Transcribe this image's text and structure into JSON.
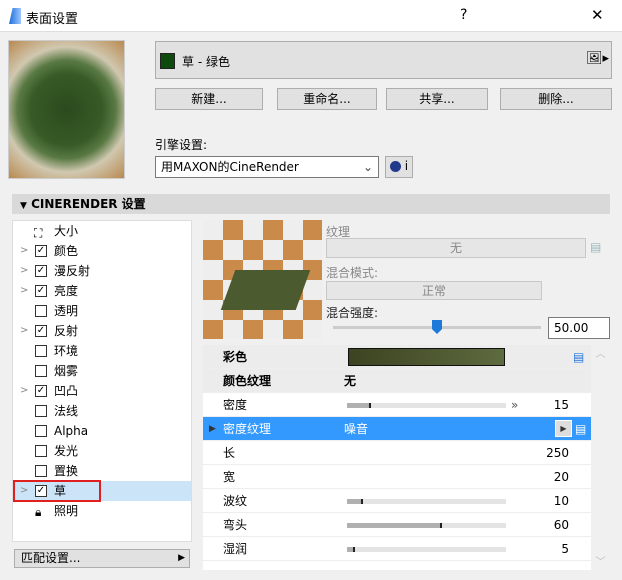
{
  "window": {
    "title": "表面设置",
    "help": "?",
    "close": "✕"
  },
  "material": {
    "name": "草 - 绿色",
    "swatch": "#0e4a0e"
  },
  "buttons": {
    "new": "新建...",
    "rename": "重命名...",
    "share": "共享...",
    "delete": "删除..."
  },
  "engine": {
    "label": "引擎设置:",
    "value": "用MAXON的CineRender",
    "info": "i"
  },
  "section": {
    "title": "CINERENDER 设置"
  },
  "channels": [
    {
      "label": "大小",
      "icon": "size",
      "expand": false
    },
    {
      "label": "颜色",
      "checked": true,
      "expand": true
    },
    {
      "label": "漫反射",
      "checked": true,
      "expand": true
    },
    {
      "label": "亮度",
      "checked": true,
      "expand": true
    },
    {
      "label": "透明",
      "checked": false,
      "expand": false
    },
    {
      "label": "反射",
      "checked": true,
      "expand": true
    },
    {
      "label": "环境",
      "checked": false,
      "expand": false
    },
    {
      "label": "烟雾",
      "checked": false,
      "expand": false
    },
    {
      "label": "凹凸",
      "checked": true,
      "expand": true
    },
    {
      "label": "法线",
      "checked": false,
      "expand": false
    },
    {
      "label": "Alpha",
      "checked": false,
      "expand": false
    },
    {
      "label": "发光",
      "checked": false,
      "expand": false
    },
    {
      "label": "置换",
      "checked": false,
      "expand": false
    },
    {
      "label": "草",
      "checked": true,
      "expand": true,
      "selected": true
    },
    {
      "label": "照明",
      "icon": "lock",
      "expand": false
    }
  ],
  "match_button": "匹配设置...",
  "texture": {
    "label": "纹理",
    "value": "无",
    "blend_mode_label": "混合模式:",
    "blend_mode": "正常",
    "blend_strength_label": "混合强度:",
    "blend_strength": "50.00",
    "blend_fraction": 0.5
  },
  "props": {
    "color_label": "彩色",
    "color": "#4a5228",
    "color_tex_label": "颜色纹理",
    "color_tex": "无",
    "rows": [
      {
        "label": "密度",
        "value": "15",
        "fraction": 0.15
      },
      {
        "label": "密度纹理",
        "value": "噪音",
        "selected": true
      },
      {
        "label": "长",
        "value": "250"
      },
      {
        "label": "宽",
        "value": "20"
      },
      {
        "label": "波纹",
        "value": "10",
        "fraction": 0.1
      },
      {
        "label": "弯头",
        "value": "60",
        "fraction": 0.6
      },
      {
        "label": "湿润",
        "value": "5",
        "fraction": 0.05
      }
    ]
  }
}
